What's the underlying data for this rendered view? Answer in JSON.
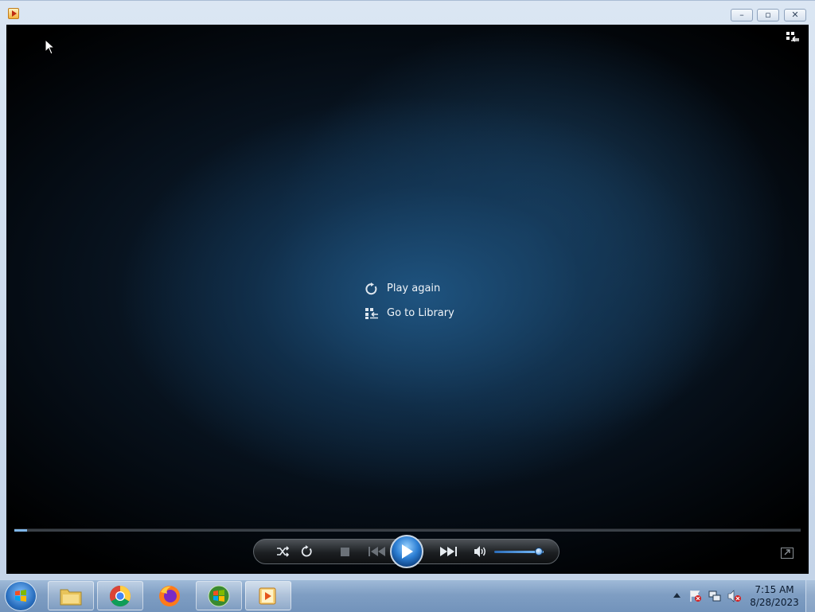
{
  "window": {
    "minimize_glyph": "–",
    "maximize_glyph": "▫",
    "close_glyph": "✕"
  },
  "center_menu": {
    "play_again": "Play again",
    "go_to_library": "Go to Library"
  },
  "playback": {
    "seek_progress_fraction": 0.016,
    "volume_fraction": 0.9
  },
  "taskbar": {
    "apps": [
      "file-explorer",
      "chrome",
      "firefox",
      "windows-media-center",
      "windows-media-player"
    ],
    "time": "7:15 AM",
    "date": "8/28/2023"
  },
  "colors": {
    "accent": "#2d7fd4",
    "video_bg": "#0b1a2b"
  }
}
